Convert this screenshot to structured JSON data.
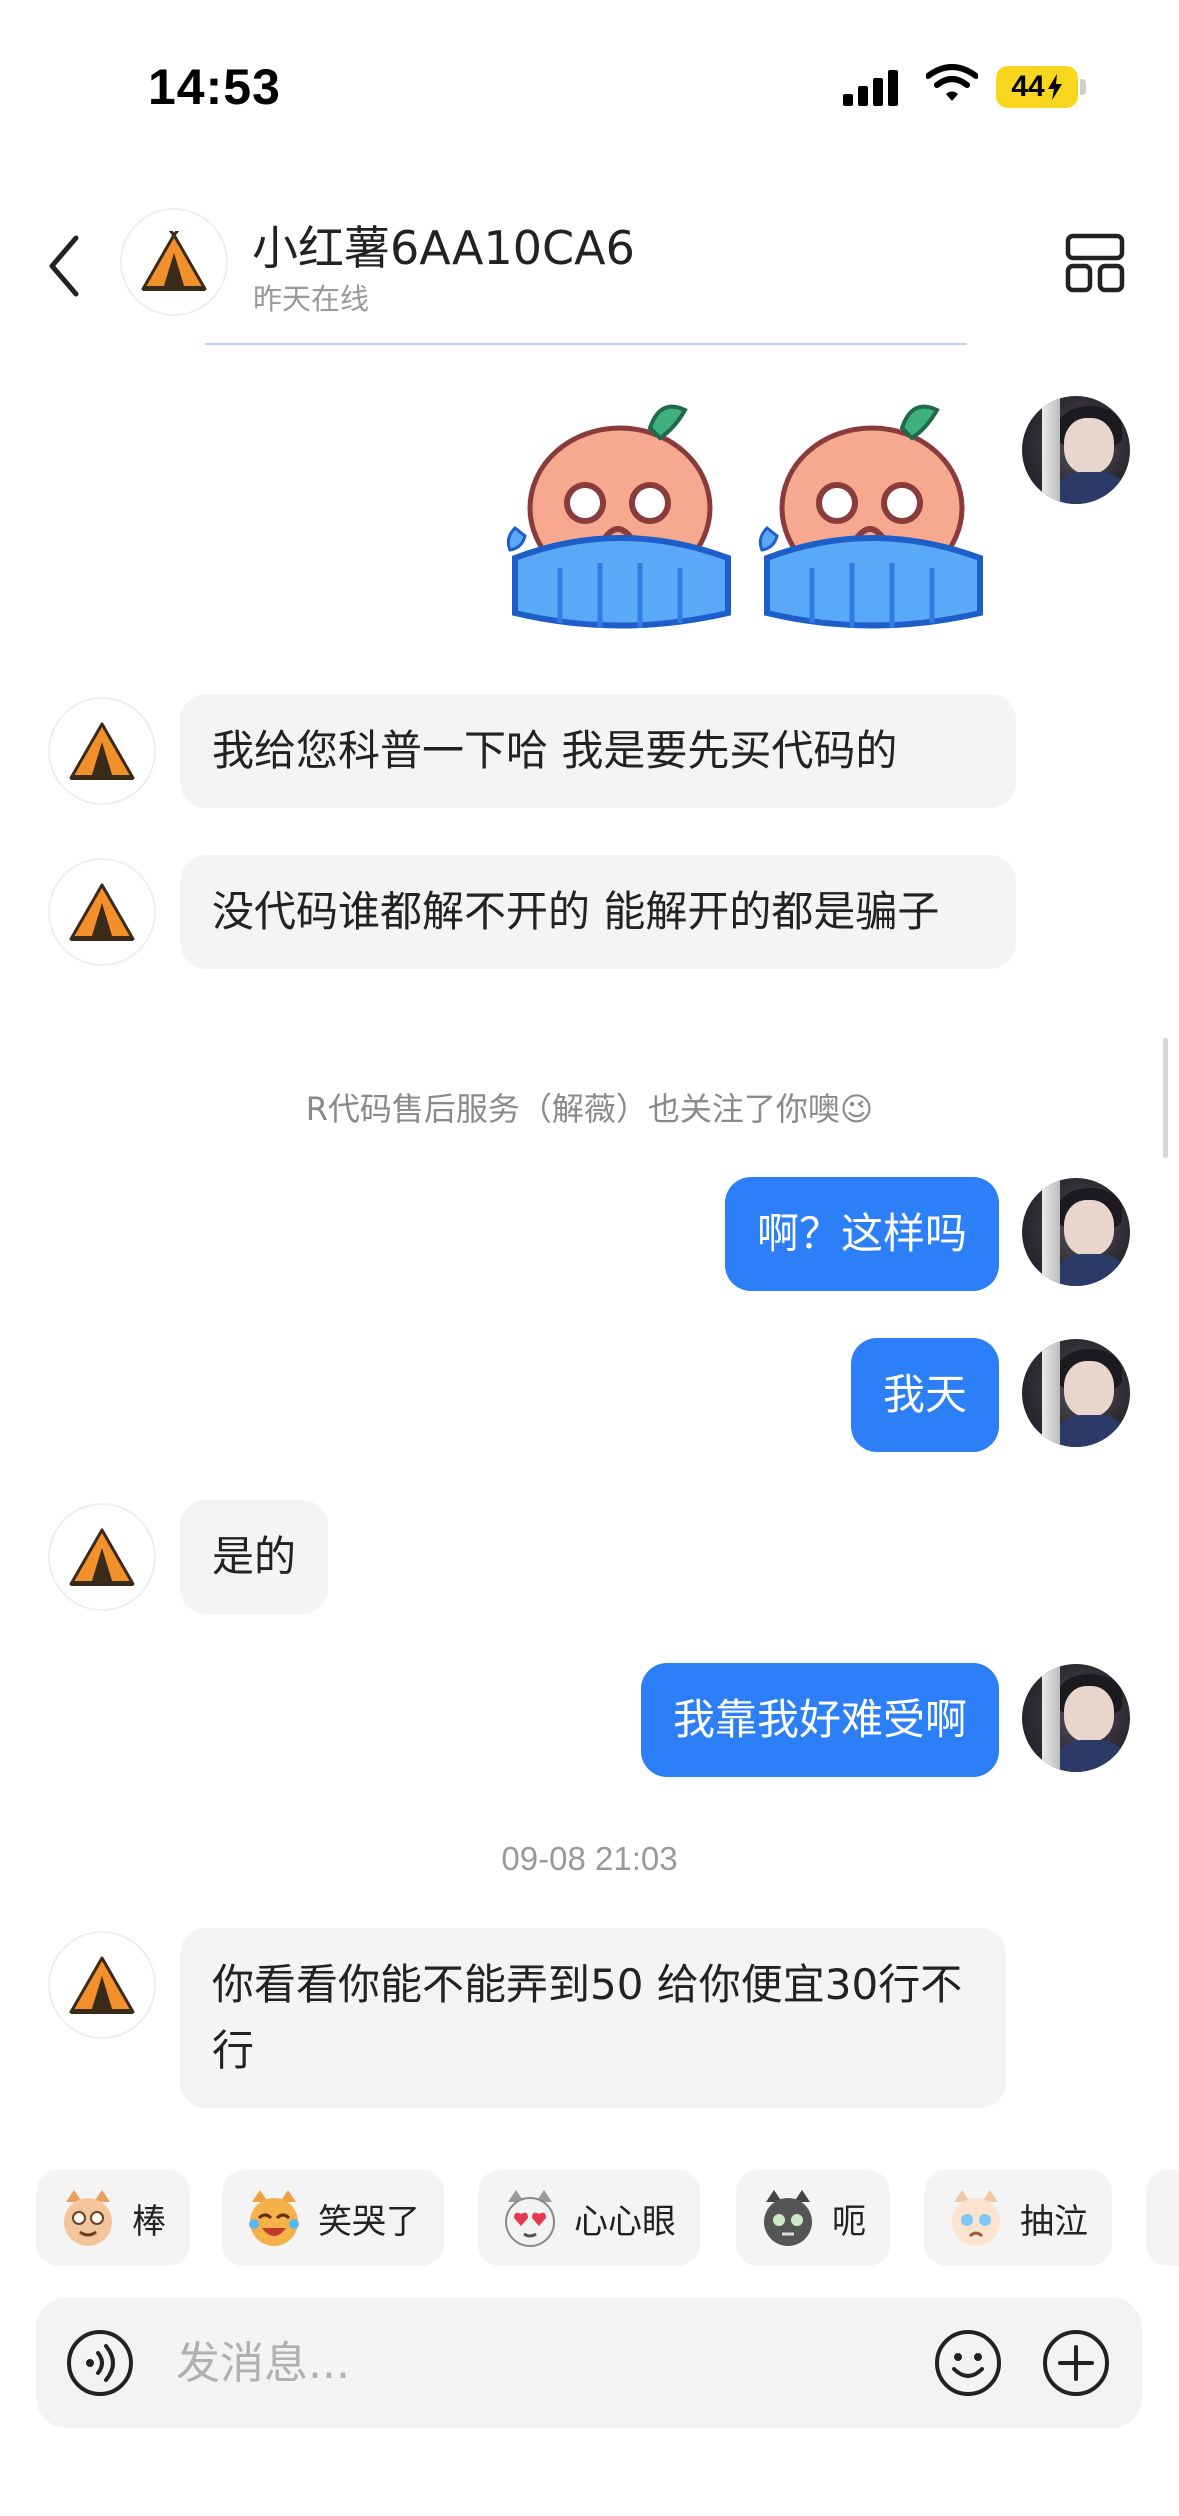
{
  "status_bar": {
    "time": "14:53",
    "battery": "44"
  },
  "header": {
    "contact_name": "小红薯6AA10CA6",
    "contact_status": "昨天在线",
    "icons": {
      "back": "chevron-left-icon",
      "layout": "layout-grid-icon"
    }
  },
  "messages": {
    "sticker_sender": "me",
    "in_1": "我给您科普一下哈 我是要先买代码的",
    "in_2": "没代码谁都解不开的 能解开的都是骗子",
    "system_note": "R代码售后服务（解薇）也关注了你噢😉",
    "out_1": "啊？这样吗",
    "out_2": "我天",
    "in_3": "是的",
    "out_3": "我靠我好难受啊",
    "timestamp": "09-08 21:03",
    "in_4": "你看看你能不能弄到50 给你便宜30行不行"
  },
  "quick_replies": [
    {
      "label": "棒",
      "icon": "cat-face-icon"
    },
    {
      "label": "笑哭了",
      "icon": "laughing-cat-icon"
    },
    {
      "label": "心心眼",
      "icon": "heart-eyes-cat-icon"
    },
    {
      "label": "呃",
      "icon": "speechless-cat-icon"
    },
    {
      "label": "抽泣",
      "icon": "sobbing-cat-icon"
    }
  ],
  "input": {
    "placeholder": "发消息..."
  },
  "colors": {
    "accent_blue": "#2c7ff6",
    "bubble_gray": "#f4f4f4",
    "battery_yellow": "#f8d61e",
    "tent_orange": "#f2902b"
  }
}
